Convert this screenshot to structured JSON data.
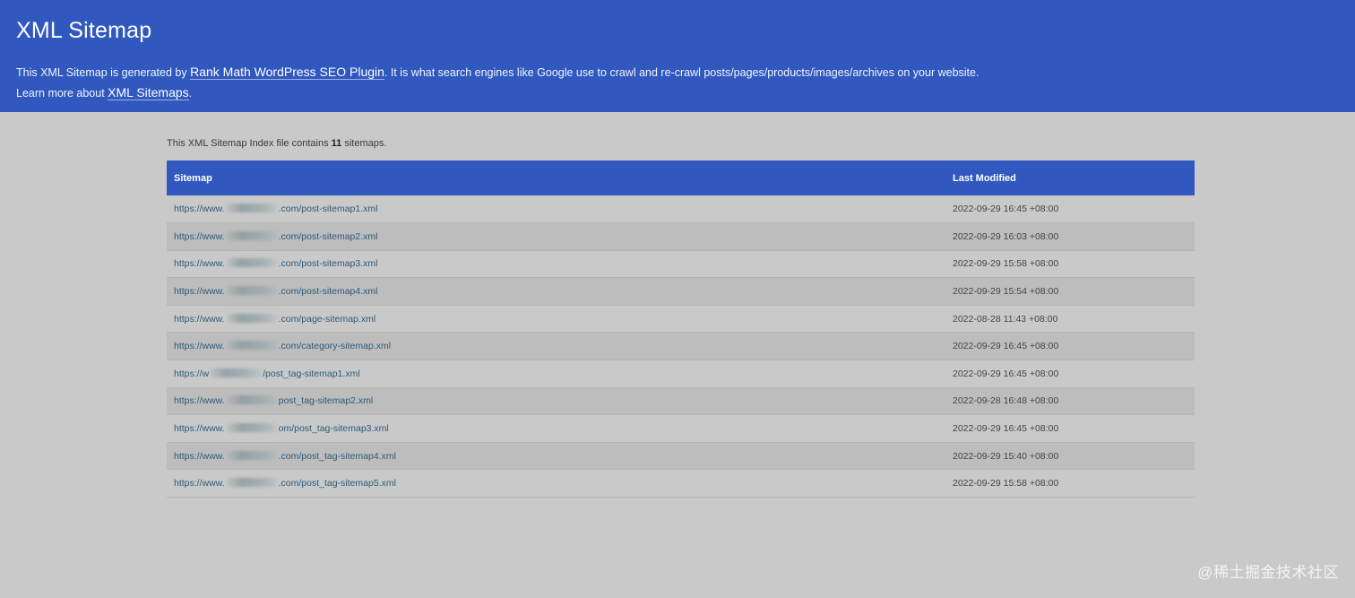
{
  "header": {
    "title": "XML Sitemap",
    "line1_prefix": "This XML Sitemap is generated by ",
    "line1_link": "Rank Math WordPress SEO Plugin",
    "line1_suffix": ". It is what search engines like Google use to crawl and re-crawl posts/pages/products/images/archives on your website.",
    "line2_prefix": "Learn more about ",
    "line2_link": "XML Sitemaps",
    "line2_suffix": "."
  },
  "summary": {
    "prefix": "This XML Sitemap Index file contains ",
    "count": "11",
    "suffix": " sitemaps."
  },
  "table": {
    "columns": [
      "Sitemap",
      "Last Modified"
    ],
    "rows": [
      {
        "url_start": "https://www.",
        "url_end": ".com/post-sitemap1.xml",
        "modified": "2022-09-29 16:45 +08:00"
      },
      {
        "url_start": "https://www.",
        "url_end": ".com/post-sitemap2.xml",
        "modified": "2022-09-29 16:03 +08:00"
      },
      {
        "url_start": "https://www.",
        "url_end": ".com/post-sitemap3.xml",
        "modified": "2022-09-29 15:58 +08:00"
      },
      {
        "url_start": "https://www.",
        "url_end": ".com/post-sitemap4.xml",
        "modified": "2022-09-29 15:54 +08:00"
      },
      {
        "url_start": "https://www.",
        "url_end": ".com/page-sitemap.xml",
        "modified": "2022-08-28 11:43 +08:00"
      },
      {
        "url_start": "https://www.",
        "url_end": ".com/category-sitemap.xml",
        "modified": "2022-09-29 16:45 +08:00"
      },
      {
        "url_start": "https://w",
        "url_end": "/post_tag-sitemap1.xml",
        "modified": "2022-09-29 16:45 +08:00"
      },
      {
        "url_start": "https://www.",
        "url_end": "post_tag-sitemap2.xml",
        "modified": "2022-09-28 16:48 +08:00"
      },
      {
        "url_start": "https://www.",
        "url_end": "om/post_tag-sitemap3.xml",
        "modified": "2022-09-29 16:45 +08:00"
      },
      {
        "url_start": "https://www.",
        "url_end": ".com/post_tag-sitemap4.xml",
        "modified": "2022-09-29 15:40 +08:00"
      },
      {
        "url_start": "https://www.",
        "url_end": ".com/post_tag-sitemap5.xml",
        "modified": "2022-09-29 15:58 +08:00"
      }
    ]
  },
  "watermark": "@稀土掘金技术社区",
  "colors": {
    "brand_blue": "#3158bf",
    "link": "#2d5a78",
    "background": "#c9c9c9"
  }
}
